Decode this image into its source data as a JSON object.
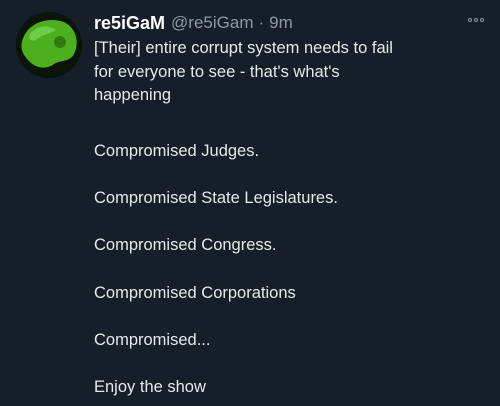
{
  "tweet": {
    "display_name": "re5iGaM",
    "handle": "@re5iGam",
    "separator": "·",
    "time": "9m",
    "intro_lines": [
      "[Their] entire corrupt system needs to fail",
      "for everyone to see - that's what's",
      "happening"
    ],
    "lines": [
      "Compromised Judges.",
      "Compromised State Legislatures.",
      "Compromised Congress.",
      "Compromised Corporations",
      "Compromised...",
      "Enjoy the show"
    ]
  }
}
